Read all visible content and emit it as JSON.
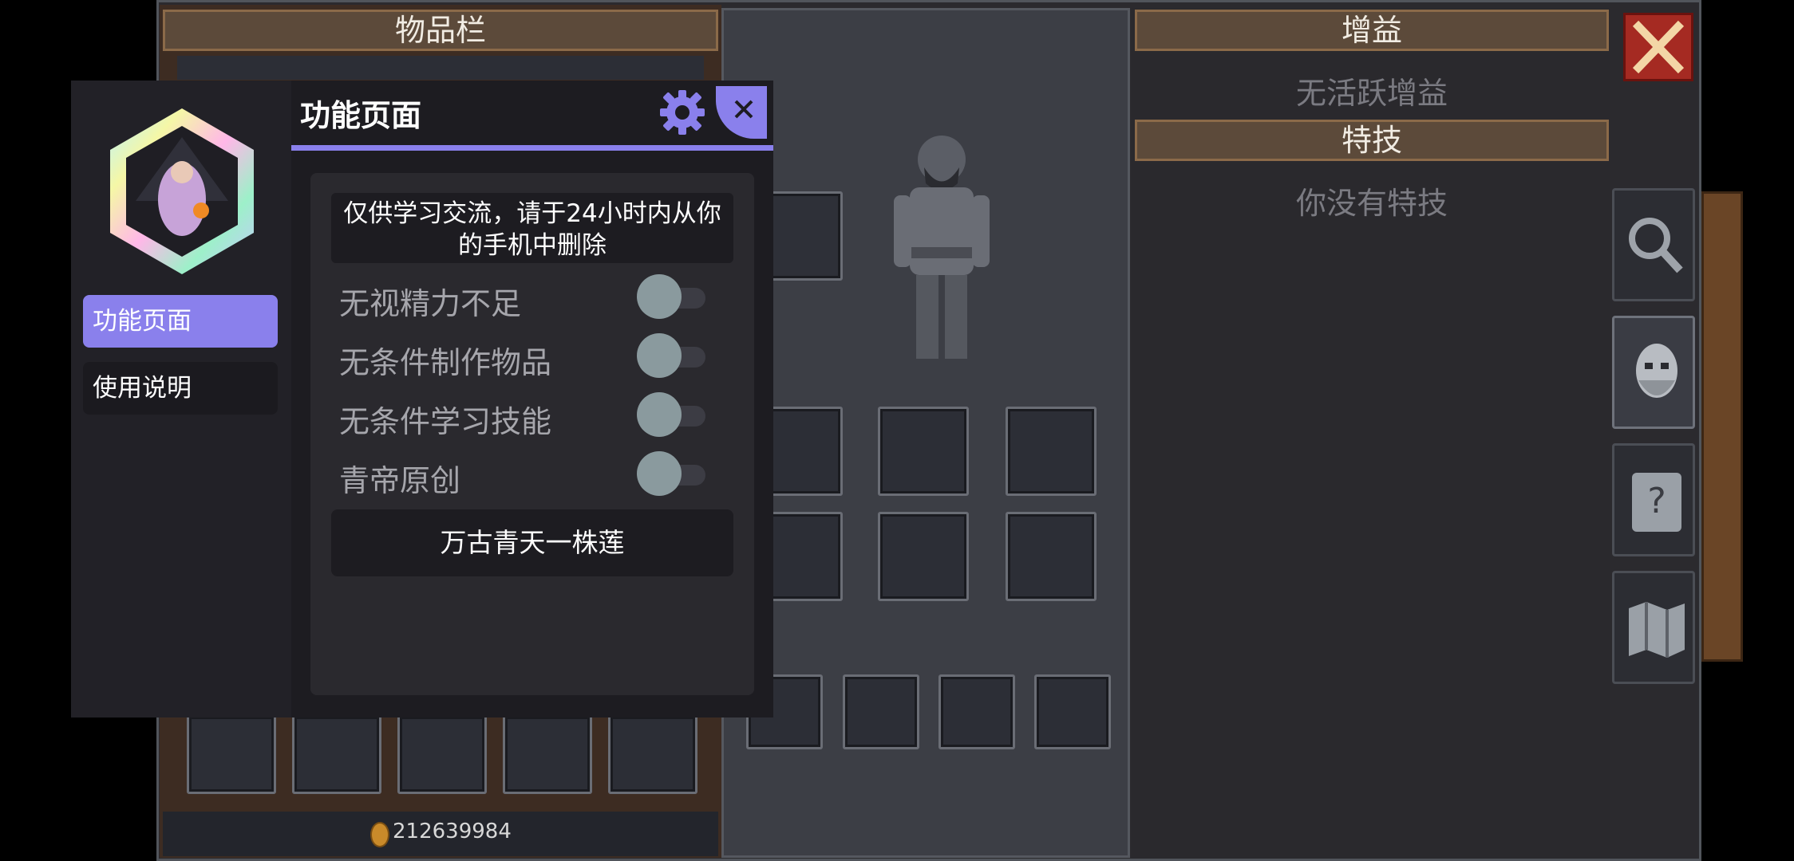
{
  "inventory": {
    "title": "物品栏",
    "gold_amount": "212639984"
  },
  "buffs": {
    "title": "增益",
    "empty_text": "无活跃增益"
  },
  "perks": {
    "title": "特技",
    "empty_text": "你没有特技"
  },
  "menu": {
    "header_title": "功能页面",
    "nav": [
      {
        "label": "功能页面",
        "active": true
      },
      {
        "label": "使用说明",
        "active": false
      }
    ],
    "notice": "仅供学习交流，请于24小时内从你的手机中删除",
    "options": [
      {
        "label": "无视精力不足",
        "enabled": false
      },
      {
        "label": "无条件制作物品",
        "enabled": false
      },
      {
        "label": "无条件学习技能",
        "enabled": false
      },
      {
        "label": "青帝原创",
        "enabled": false
      }
    ],
    "action_button": "万古青天一株莲",
    "accent_color": "#8a80ec"
  },
  "icons": {
    "close_game": "close-x-icon",
    "side_tabs": [
      "magnifier-icon",
      "character-head-icon",
      "quest-book-icon",
      "map-icon"
    ]
  }
}
